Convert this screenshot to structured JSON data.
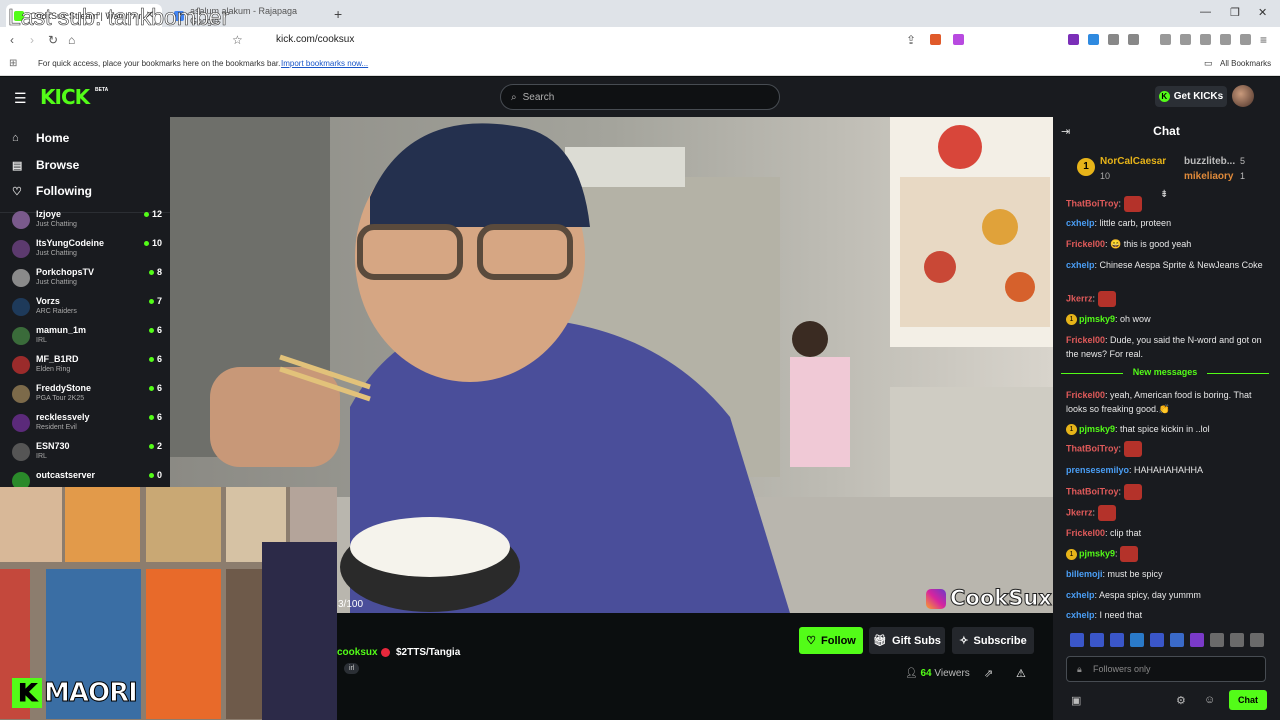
{
  "browser": {
    "tabs": [
      {
        "label": "CookSux Stream | Watch Ar",
        "active": true
      },
      {
        "label": "asalum alakum - Rajapaga Google",
        "active": false
      }
    ],
    "url": "kick.com/cooksux",
    "bookmark_prompt": "For quick access, place your bookmarks here on the bookmarks bar.",
    "import_link": "Import bookmarks now...",
    "all_bookmarks": "All Bookmarks"
  },
  "overlay": {
    "last_sub": "Last sub: tankbomber",
    "maori": "MAORI",
    "watermark": "CookSux",
    "counter": "3/100"
  },
  "header": {
    "logo": "KICK",
    "beta": "BETA",
    "search_placeholder": "Search",
    "get_kicks": "Get KICKs"
  },
  "sidebar": {
    "nav": [
      {
        "label": "Home",
        "icon": "home-icon"
      },
      {
        "label": "Browse",
        "icon": "browse-icon"
      },
      {
        "label": "Following",
        "icon": "heart-icon"
      }
    ],
    "channels": [
      {
        "name": "lzjoye",
        "category": "Just Chatting",
        "viewers": "12",
        "color": "#7a5a8c"
      },
      {
        "name": "ItsYungCodeine",
        "category": "Just Chatting",
        "viewers": "10",
        "color": "#5c3a6e"
      },
      {
        "name": "PorkchopsTV",
        "category": "Just Chatting",
        "viewers": "8",
        "color": "#8a8a8a"
      },
      {
        "name": "Vorzs",
        "category": "ARC Raiders",
        "viewers": "7",
        "color": "#1e3a5a"
      },
      {
        "name": "mamun_1m",
        "category": "IRL",
        "viewers": "6",
        "color": "#3a6b3a"
      },
      {
        "name": "MF_B1RD",
        "category": "Elden Ring",
        "viewers": "6",
        "color": "#9b2b2b"
      },
      {
        "name": "FreddyStone",
        "category": "PGA Tour 2K25",
        "viewers": "6",
        "color": "#7c6a4a"
      },
      {
        "name": "recklessvely",
        "category": "Resident Evil",
        "viewers": "6",
        "color": "#5b2a7a"
      },
      {
        "name": "ESN730",
        "category": "IRL",
        "viewers": "2",
        "color": "#555555"
      },
      {
        "name": "outcastserver",
        "category": "",
        "viewers": "0",
        "color": "#2a8a2a"
      }
    ]
  },
  "stream": {
    "streamer": "cooksux",
    "title": "$2TTS/Tangia",
    "tag": "irl",
    "follow": "Follow",
    "gift_subs": "Gift Subs",
    "subscribe": "Subscribe",
    "viewers_count": "64",
    "viewers_label": "Viewers"
  },
  "chat": {
    "title": "Chat",
    "leaderboard": {
      "first_name": "NorCalCaesar",
      "first_count": "10",
      "second_name": "buzzliteb...",
      "second_count": "5",
      "third_name": "mikeliaory",
      "third_count": "1"
    },
    "messages": [
      {
        "user": "ThatBoiTroy",
        "text": "",
        "color": "#e05a5a",
        "emote": true
      },
      {
        "user": "cxhelp",
        "text": "little carb, proteen",
        "color": "#4a9ef5"
      },
      {
        "user": "Frickel00",
        "text": "😄 this is good yeah",
        "color": "#e05a5a"
      },
      {
        "user": "cxhelp",
        "text": "Chinese Aespa Sprite & NewJeans Coke",
        "color": "#4a9ef5"
      },
      {
        "user": "Jkerrz",
        "text": "",
        "color": "#e05a5a",
        "emote": true
      },
      {
        "user": "pjmsky9",
        "text": "oh wow",
        "color": "#53fc18",
        "badge": true
      },
      {
        "user": "Frickel00",
        "text": "Dude, you said the N-word and got on the news? For real.",
        "color": "#e05a5a"
      },
      {
        "user": "Frickel00",
        "text": "yeah, American food is boring. That looks so freaking good.👏",
        "color": "#e05a5a"
      },
      {
        "user": "pjmsky9",
        "text": "that spice kickin in ..lol",
        "color": "#53fc18",
        "badge": true
      },
      {
        "user": "ThatBoiTroy",
        "text": "",
        "color": "#e05a5a",
        "emote": true
      },
      {
        "user": "prensesemilyo",
        "text": "HAHAHAHAHHA",
        "color": "#4a9ef5"
      },
      {
        "user": "ThatBoiTroy",
        "text": "",
        "color": "#e05a5a",
        "emote": true
      },
      {
        "user": "Jkerrz",
        "text": "",
        "color": "#e05a5a",
        "emote": true
      },
      {
        "user": "Frickel00",
        "text": "clip that",
        "color": "#e05a5a"
      },
      {
        "user": "pjmsky9",
        "text": "",
        "color": "#53fc18",
        "badge": true,
        "emote": true
      },
      {
        "user": "billemoji",
        "text": "must be spicy",
        "color": "#4a9ef5"
      },
      {
        "user": "cxhelp",
        "text": "Aespa spicy, day yummm",
        "color": "#4a9ef5"
      },
      {
        "user": "cxhelp",
        "text": "I need that",
        "color": "#4a9ef5"
      }
    ],
    "new_messages": "New messages",
    "input_placeholder": "Followers only",
    "send": "Chat"
  },
  "colors": {
    "accent": "#53fc18",
    "bg": "#0b0e0f",
    "panel": "#191b1f"
  }
}
